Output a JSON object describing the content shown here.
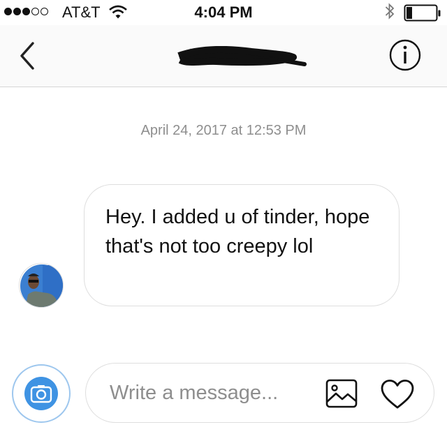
{
  "status_bar": {
    "carrier": "AT&T",
    "time": "4:04 PM",
    "signal_strength": "3 of 5",
    "bluetooth": "bluetooth-icon",
    "battery_level": 0.2,
    "wifi": "wifi-icon"
  },
  "header": {
    "back": "chevron-left-icon",
    "contact_name": "beelalk",
    "contact_name_note": "scribbled out",
    "info": "info-icon"
  },
  "thread": {
    "timestamp": "April 24, 2017 at 12:53 PM",
    "messages": [
      {
        "sender": "other",
        "text": "Hey. I added u of tinder, hope that's not too creepy lol"
      }
    ]
  },
  "composer": {
    "placeholder": "Write a message...",
    "camera": "camera-icon",
    "gallery": "image-icon",
    "like": "heart-icon"
  },
  "colors": {
    "accent_blue": "#3f93e3",
    "timestamp_gray": "#8e8e8e",
    "border_gray": "#dedede"
  }
}
